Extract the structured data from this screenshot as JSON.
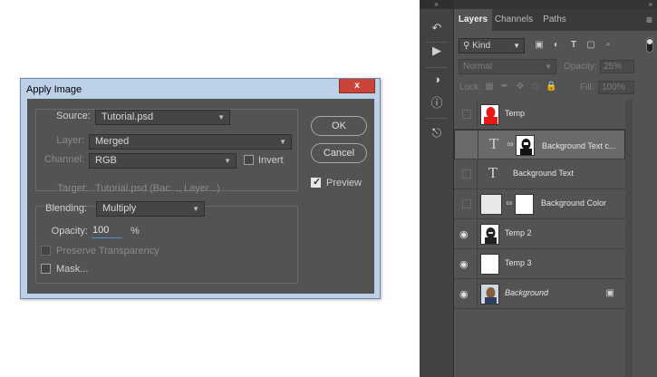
{
  "dialog": {
    "title": "Apply Image",
    "close_glyph": "x",
    "source": {
      "label": "Source:",
      "value": "Tutorial.psd"
    },
    "layer": {
      "label": "Layer:",
      "value": "Merged"
    },
    "channel": {
      "label": "Channel:",
      "value": "RGB"
    },
    "invert_label": "Invert",
    "target": {
      "label": "Target:",
      "value": "Tutorial.psd (Bac..., Layer...)"
    },
    "blending": {
      "label": "Blending:",
      "value": "Multiply"
    },
    "opacity": {
      "label": "Opacity:",
      "value": "100",
      "unit": "%"
    },
    "preserve_label": "Preserve Transparency",
    "mask_label": "Mask...",
    "ok_label": "OK",
    "cancel_label": "Cancel",
    "preview_label": "Preview",
    "preview_checked": true
  },
  "panel": {
    "top_collapse": "»",
    "tabs": [
      {
        "label": "Layers",
        "active": true
      },
      {
        "label": "Channels",
        "active": false
      },
      {
        "label": "Paths",
        "active": false
      }
    ],
    "menu_glyph": "≡",
    "filter": {
      "label": "Kind"
    },
    "blend_mode": {
      "value": "Normal"
    },
    "opacity": {
      "label": "Opacity:",
      "value": "25%"
    },
    "lock_label": "Lock:",
    "fill": {
      "label": "Fill:",
      "value": "100%"
    },
    "layers": [
      {
        "name": "Temp",
        "visible": false,
        "kind": "red-thumb"
      },
      {
        "name": "Background Text c...",
        "visible": false,
        "kind": "text-mask",
        "selected": true
      },
      {
        "name": "Background Text",
        "visible": false,
        "kind": "text"
      },
      {
        "name": "Background Color",
        "visible": false,
        "kind": "fill-mask"
      },
      {
        "name": "Temp 2",
        "visible": true,
        "kind": "bw-thumb"
      },
      {
        "name": "Temp 3",
        "visible": true,
        "kind": "white-thumb"
      },
      {
        "name": "Background",
        "visible": true,
        "kind": "photo-thumb",
        "italic": true,
        "locked": true
      }
    ]
  },
  "icons": {
    "text": "T",
    "eye": "◉",
    "chain": "⛓"
  }
}
